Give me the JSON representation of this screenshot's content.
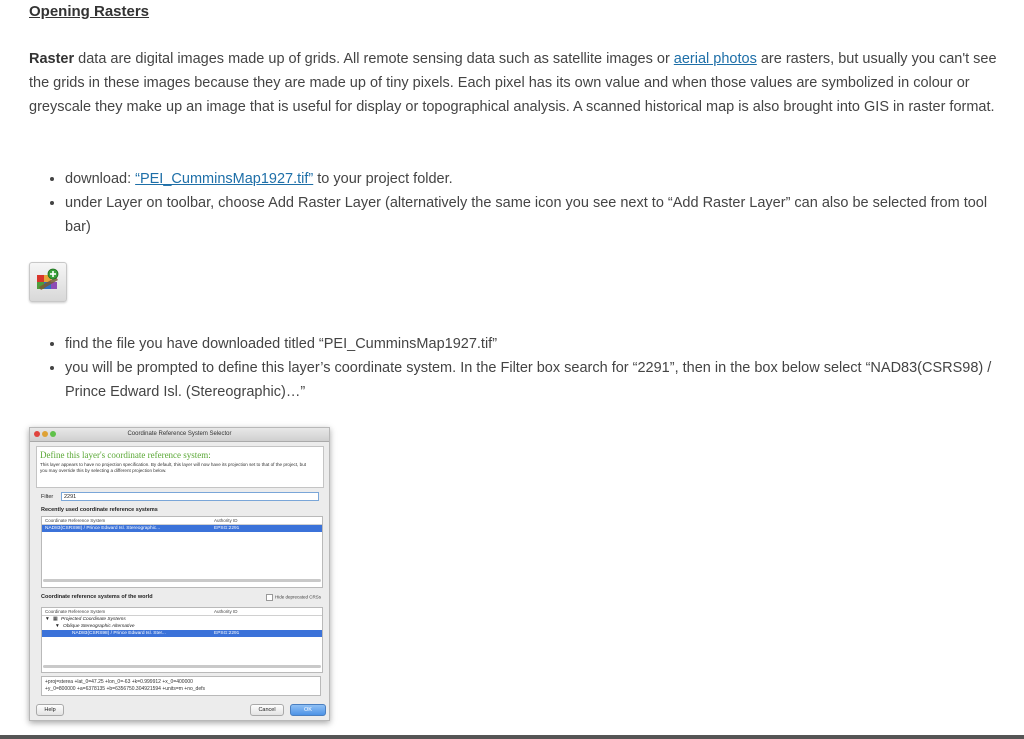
{
  "heading": "Opening Rasters",
  "intro": {
    "bold_word": "Raster",
    "text_1": " data are digital images made up of grids. All remote sensing data such as satellite images or ",
    "link_aerial": "aerial photos",
    "text_2": " are rasters, but usually you can't see the grids in these images because they are made up of tiny pixels.  Each pixel has its own value and when those values are symbolized in colour or greyscale they make up an image that is useful for display or topographical analysis.  A scanned historical map is also brought into GIS in raster format."
  },
  "steps_1": {
    "download_prefix": "download: ",
    "download_link": "“PEI_CumminsMap1927.tif”",
    "download_suffix": " to your project folder.",
    "layer_step": "under Layer on toolbar, choose Add Raster Layer (alternatively the same icon you see next to “Add Raster Layer” can also be selected from tool bar)"
  },
  "steps_2": {
    "find_step": "find the file you have downloaded titled “PEI_CumminsMap1927.tif”",
    "prompt_step": "you will be prompted to define this layer’s coordinate system. In the Filter box search for “2291”, then in the box below select “NAD83(CSRS98) / Prince Edward Isl. (Stereographic)…”"
  },
  "icons": {
    "add_raster": "add-raster-layer-icon"
  },
  "dialog": {
    "title": "Coordinate Reference System Selector",
    "intro_heading": "Define this layer's coordinate reference system:",
    "intro_text": "This layer appears to have no projection specification. By default, this layer will now have its projection set to that of the project, but you may override this by selecting a different projection below.",
    "filter_label": "Filter",
    "filter_value": "2291",
    "recent_heading": "Recently used coordinate reference systems",
    "col_crs": "Coordinate Reference System",
    "col_auth": "Authority ID",
    "recent_row": {
      "crs": "NAD83(CSRS98) / Prince Edward Isl. Stereographic...",
      "auth": "EPSG:2291"
    },
    "world_heading": "Coordinate reference systems of the world",
    "hide_deprecated": "Hide deprecated CRSs",
    "tree_projected": "Projected Coordinate Systems",
    "tree_oblique": "Oblique Stereographic Alternative",
    "world_row": {
      "crs": "NAD83(CSRS98) / Prince Edward Isl. Ster...",
      "auth": "EPSG:2291"
    },
    "proj_line_1": "+proj=sterea +lat_0=47.25 +lon_0=-63 +k=0.999912 +x_0=400000",
    "proj_line_2": "+y_0=800000 +a=6378135 +b=6356750.304921594 +units=m +no_defs",
    "help": "Help",
    "cancel": "Cancel",
    "ok": "OK"
  }
}
